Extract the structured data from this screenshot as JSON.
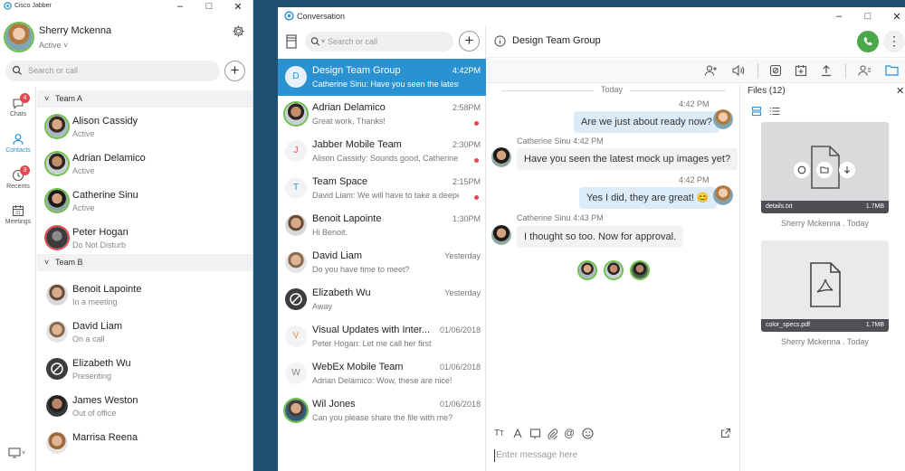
{
  "left_window": {
    "app_title": "Cisco Jabber",
    "user": {
      "name": "Sherry Mckenna",
      "status": "Active"
    },
    "search_placeholder": "Search or call",
    "nav": [
      {
        "label": "Chats",
        "badge": "4"
      },
      {
        "label": "Contacts",
        "badge": ""
      },
      {
        "label": "Recents",
        "badge": "3"
      },
      {
        "label": "Meetings",
        "badge": ""
      }
    ],
    "groups": [
      {
        "name": "Team A",
        "contacts": [
          {
            "name": "Alison Cassidy",
            "status": "Active"
          },
          {
            "name": "Adrian Delamico",
            "status": "Active"
          },
          {
            "name": "Catherine Sinu",
            "status": "Active"
          },
          {
            "name": "Peter Hogan",
            "status": "Do Not Disturb"
          }
        ]
      },
      {
        "name": "Team B",
        "contacts": [
          {
            "name": "Benoit Lapointe",
            "status": "In a meeting"
          },
          {
            "name": "David Liam",
            "status": "On a call"
          },
          {
            "name": "Elizabeth Wu",
            "status": "Presenting"
          },
          {
            "name": "James Weston",
            "status": "Out of office"
          },
          {
            "name": "Marrisa Reena",
            "status": ""
          }
        ]
      }
    ]
  },
  "conversation_window": {
    "title": "Conversation",
    "search_placeholder": "Search or call",
    "header_title": "Design Team Group",
    "conversations": [
      {
        "name": "Design Team Group",
        "preview": "Catherine Sinu: Have you seen the latest mo",
        "time": "4:42PM",
        "letter": "D"
      },
      {
        "name": "Adrian Delamico",
        "preview": "Great work, Thanks!",
        "time": "2:58PM"
      },
      {
        "name": "Jabber Mobile Team",
        "preview": "Alison Cassidy: Sounds good, Catherine",
        "time": "2:30PM",
        "letter": "J"
      },
      {
        "name": "Team Space",
        "preview": "David Liam: We will have to take a deeper loo",
        "time": "2:15PM",
        "letter": "T"
      },
      {
        "name": "Benoit Lapointe",
        "preview": "Hi Benoit.",
        "time": "1:30PM"
      },
      {
        "name": "David Liam",
        "preview": "Do you have time to meet?",
        "time": "Yesterday"
      },
      {
        "name": "Elizabeth Wu",
        "preview": "Away",
        "time": "Yesterday"
      },
      {
        "name": "Visual Updates with Inter...",
        "preview": "Peter Hogan: Let me call her first",
        "time": "01/06/2018",
        "letter": "V"
      },
      {
        "name": "WebEx Mobile Team",
        "preview": "Adrian Delamico: Wow, these are nice!",
        "time": "01/06/2018",
        "letter": "W"
      },
      {
        "name": "Wil Jones",
        "preview": "Can you please share the file with me?",
        "time": "01/06/2018"
      }
    ],
    "day_label": "Today",
    "messages": [
      {
        "sender": "",
        "time": "4:42 PM",
        "text": "Are we just about ready now?"
      },
      {
        "sender": "Catherine Sinu",
        "time": "4:42 PM",
        "text": "Have you seen the latest mock up images yet?"
      },
      {
        "sender": "",
        "time": "4:42 PM",
        "text": "Yes I did, they are great! 😊"
      },
      {
        "sender": "Catherine Sinu",
        "time": "4:43 PM",
        "text": "I thought so too. Now for approval."
      }
    ],
    "compose_placeholder": "Enter message here",
    "files": {
      "title": "Files (12)",
      "items": [
        {
          "name": "details.txt",
          "size": "1.7MB",
          "owner": "Sherry Mckenna . Today"
        },
        {
          "name": "color_specs.pdf",
          "size": "1.7MB",
          "owner": "Sherry Mckenna . Today"
        }
      ]
    }
  },
  "colors": {
    "accent": "#2a92d1",
    "call_green": "#4aa84a",
    "presence": "#6cc04a",
    "badge": "#e5484d",
    "desktop": "#1d4f73"
  }
}
